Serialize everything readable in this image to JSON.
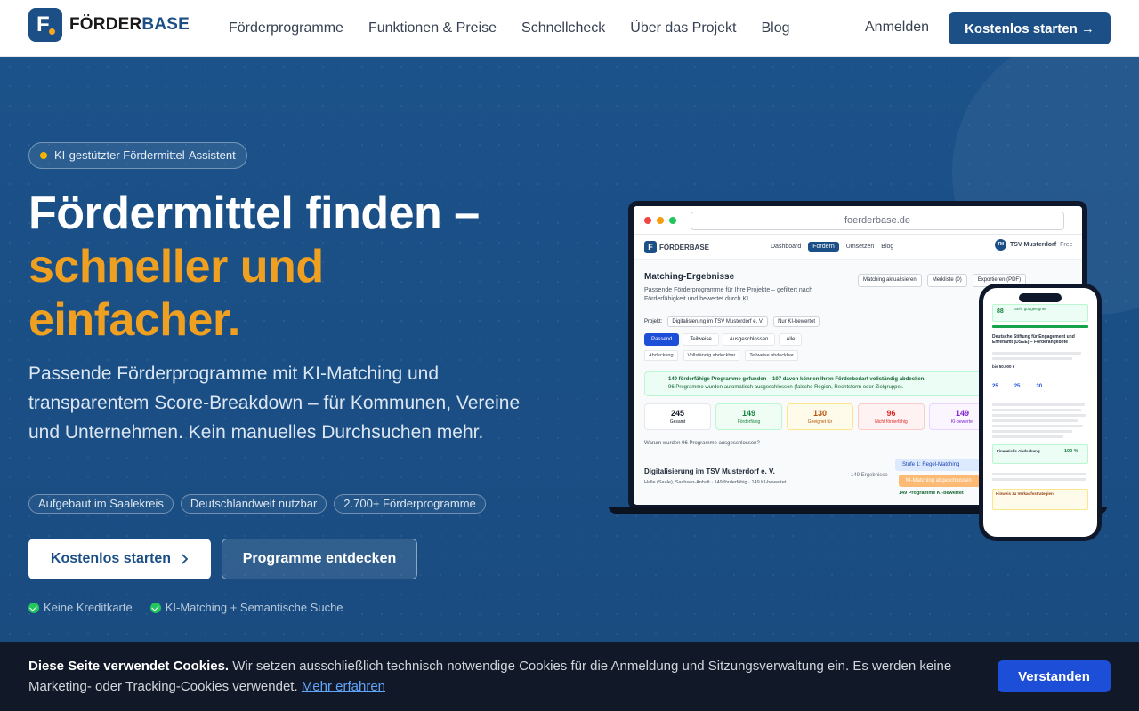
{
  "nav": {
    "brand_a": "FÖRDER",
    "brand_b": "BASE",
    "links": [
      "Förderprogramme",
      "Funktionen & Preise",
      "Schnellcheck",
      "Über das Projekt",
      "Blog"
    ],
    "login": "Anmelden",
    "cta": "Kostenlos starten →"
  },
  "hero": {
    "badge": "KI-gestützter Fördermittel-Assistent",
    "title_line1": "Fördermittel finden –",
    "title_line2": "schneller und",
    "title_line3": "einfacher.",
    "lead": "Passende Förderprogramme mit KI-Matching und transparentem Score-Breakdown – für Kommunen, Vereine und Unternehmen. Kein manuelles Durchsuchen mehr.",
    "chips": [
      "Aufgebaut im Saalekreis",
      "Deutschlandweit nutzbar",
      "2.700+ Förderprogramme"
    ],
    "primary_button": "Kostenlos starten",
    "secondary_button": "Programme entdecken",
    "checks": [
      "Keine Kreditkarte",
      "KI-Matching + Semantische Suche"
    ]
  },
  "mockup": {
    "url": "foerderbase.de",
    "app_brand": "FÖRDERBASE",
    "menu": [
      "Dashboard",
      "Fördern",
      "Umsetzen",
      "Blog"
    ],
    "user": "TSV Musterdorf",
    "user_initials": "TM",
    "user_plan": "Free",
    "title": "Matching-Ergebnisse",
    "subtitle": "Passende Förderprogramme für Ihre Projekte – gefiltert nach Förderfähigkeit und bewertet durch KI.",
    "actions": [
      "Matching aktualisieren",
      "Merkliste (0)",
      "Exportieren (PDF)"
    ],
    "project_label": "Projekt:",
    "project_value": "Digitalisierung im TSV Musterdorf e. V.",
    "filter": "Nur KI-bewertet",
    "tabs": [
      "Passend",
      "Teilweise",
      "Ausgeschlossen",
      "Alle"
    ],
    "subtabs": [
      "Abdeckung",
      "Vollständig abdeckbar",
      "Teilweise abdeckbar"
    ],
    "banner_title": "149 förderfähige Programme gefunden – 107 davon können Ihren Förderbedarf vollständig abdecken.",
    "banner_sub": "96 Programme wurden automatisch ausgeschlossen (falsche Region, Rechtsform oder Zielgruppe).",
    "stats": [
      {
        "value": "245",
        "label": "Gesamt",
        "color": "#111827",
        "bg": "#ffffff",
        "border": "#e5e7eb"
      },
      {
        "value": "149",
        "label": "Förderfähig",
        "color": "#15803d",
        "bg": "#f0fdf4",
        "border": "#bbf7d0"
      },
      {
        "value": "130",
        "label": "Geeignet für",
        "color": "#b45309",
        "bg": "#fffbeb",
        "border": "#fde68a"
      },
      {
        "value": "96",
        "label": "Nicht förderfähig",
        "color": "#dc2626",
        "bg": "#fef2f2",
        "border": "#fecaca"
      },
      {
        "value": "149",
        "label": "KI-bewertet",
        "color": "#7e22ce",
        "bg": "#faf5ff",
        "border": "#e9d5ff"
      }
    ],
    "why": "Warum wurden 96 Programme ausgeschlossen?",
    "project_title": "Digitalisierung im TSV Musterdorf e. V.",
    "project_meta": "Halle (Saale), Sachsen-Anhalt · 149 förderfähig · 149 KI-bewertet",
    "result_count": "149 Ergebnisse",
    "stage1": "Stufe 1: Regel-Matching",
    "stage2": "KI-Matching abgeschlossen",
    "stage_note": "149 Programme KI-bewertet"
  },
  "phone": {
    "score": "88",
    "tag": "Sehr gut geeignet",
    "program": "Deutsche Stiftung für Engagement und Ehrenamt (DSEE) – Förderangebote",
    "amount": "bis 50.000 €",
    "scores": [
      "25",
      "25",
      "30"
    ],
    "coverage_label": "Finanzielle Abdeckung",
    "coverage_value": "100 %",
    "hint": "Hinweis zu Verkaufsstrategien"
  },
  "cookie": {
    "title": "Diese Seite verwendet Cookies.",
    "text": " Wir setzen ausschließlich technisch notwendige Cookies für die Anmeldung und Sitzungsverwaltung ein. Es werden keine Marketing- oder Tracking-Cookies verwendet. ",
    "link": "Mehr erfahren",
    "button": "Verstanden"
  }
}
